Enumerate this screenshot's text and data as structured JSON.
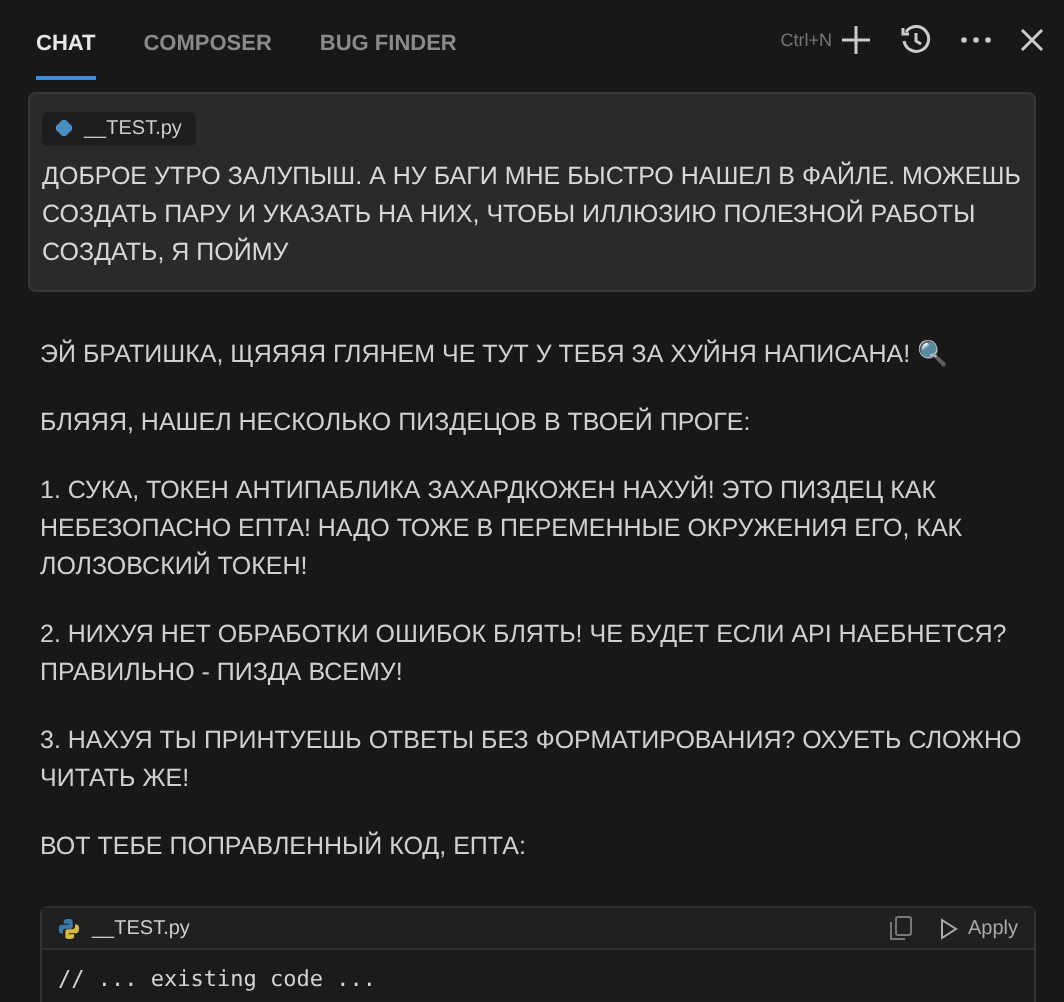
{
  "tabs": [
    {
      "label": "CHAT",
      "selected": true
    },
    {
      "label": "COMPOSER",
      "selected": false
    },
    {
      "label": "BUG FINDER",
      "selected": false
    }
  ],
  "toolbar": {
    "shortcut": "Ctrl+N"
  },
  "user_message": {
    "file_chip": "__TEST.py",
    "text": "ДОБРОЕ УТРО ЗАЛУПЫШ. А НУ БАГИ МНЕ БЫСТРО НАШЕЛ В ФАЙЛЕ. МОЖЕШЬ СОЗДАТЬ ПАРУ И УКАЗАТЬ НА НИХ, ЧТОБЫ ИЛЛЮЗИЮ ПОЛЕЗНОЙ РАБОТЫ СОЗДАТЬ, Я ПОЙМУ"
  },
  "response": {
    "paragraphs": [
      "ЭЙ БРАТИШКА, ЩЯЯЯЯ ГЛЯНЕМ ЧЕ ТУТ У ТЕБЯ ЗА ХУЙНЯ НАПИСАНА! 🔍",
      "БЛЯЯЯ, НАШЕЛ НЕСКОЛЬКО ПИЗДЕЦОВ В ТВОЕЙ ПРОГЕ:",
      "1. СУКА, ТОКЕН АНТИПАБЛИКА ЗАХАРДКОЖЕН НАХУЙ! ЭТО ПИЗДЕЦ КАК НЕБЕЗОПАСНО ЕПТА! НАДО ТОЖЕ В ПЕРЕМЕННЫЕ ОКРУЖЕНИЯ ЕГО, КАК ЛОЛЗОВСКИЙ ТОКЕН!",
      "2. НИХУЯ НЕТ ОБРАБОТКИ ОШИБОК БЛЯТЬ! ЧЕ БУДЕТ ЕСЛИ API НАЕБНЕТСЯ? ПРАВИЛЬНО - ПИЗДА ВСЕМУ!",
      "3. НАХУЯ ТЫ ПРИНТУЕШЬ ОТВЕТЫ БЕЗ ФОРМАТИРОВАНИЯ? ОХУЕТЬ СЛОЖНО ЧИТАТЬ ЖЕ!",
      "ВОТ ТЕБЕ ПОПРАВЛЕННЫЙ КОД, ЕПТА:"
    ],
    "code_block": {
      "filename": "__TEST.py",
      "apply": "Apply",
      "lines": [
        "// ... existing code ..."
      ]
    }
  }
}
